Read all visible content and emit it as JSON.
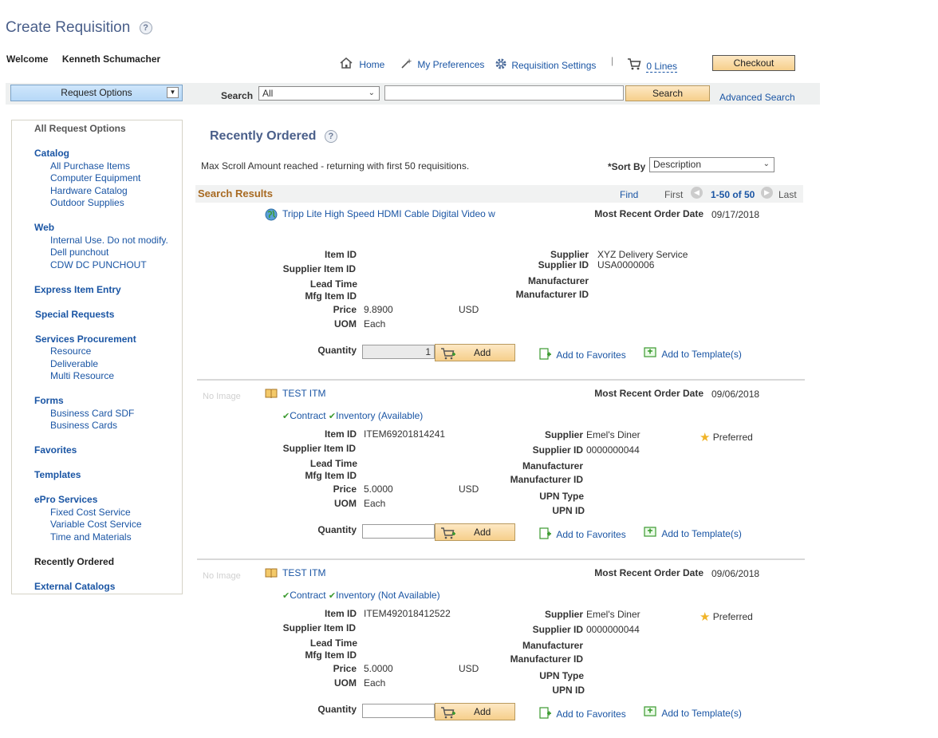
{
  "header": {
    "title": "Create Requisition",
    "help": "?",
    "welcome_label": "Welcome",
    "user_name": "Kenneth Schumacher"
  },
  "topnav": {
    "home": "Home",
    "preferences": "My Preferences",
    "settings": "Requisition Settings",
    "separator": "|",
    "cart_lines": "0 Lines",
    "checkout": "Checkout"
  },
  "toolbar": {
    "request_options": "Request Options",
    "search_label": "Search",
    "search_scope": "All",
    "search_value": "",
    "search_button": "Search",
    "advanced_search": "Advanced Search"
  },
  "sidebar": {
    "all_request_options": "All Request Options",
    "catalog": "Catalog",
    "catalog_items": [
      "All Purchase Items",
      "Computer Equipment",
      "Hardware Catalog",
      "Outdoor Supplies"
    ],
    "web": "Web",
    "web_items": [
      "Internal Use. Do not modify.",
      "Dell punchout",
      "CDW DC PUNCHOUT"
    ],
    "express": "Express Item Entry",
    "special": "Special Requests",
    "services": "Services Procurement",
    "services_items": [
      "Resource",
      "Deliverable",
      "Multi Resource"
    ],
    "forms": "Forms",
    "forms_items": [
      "Business Card SDF",
      "Business Cards"
    ],
    "favorites": "Favorites",
    "templates": "Templates",
    "epro": "ePro Services",
    "epro_items": [
      "Fixed Cost Service",
      "Variable Cost Service",
      "Time and Materials"
    ],
    "recently_ordered": "Recently Ordered",
    "external": "External Catalogs"
  },
  "main": {
    "title": "Recently Ordered",
    "help": "?",
    "scroll_msg": "Max Scroll Amount reached - returning with first 50 requisitions.",
    "sort_label": "*Sort By",
    "sort_value": "Description",
    "results_title": "Search Results",
    "find": "Find",
    "first": "First",
    "range": "1-50 of 50",
    "last": "Last"
  },
  "labels": {
    "item_id": "Item ID",
    "supplier_item_id": "Supplier Item ID",
    "lead_time": "Lead Time",
    "mfg_item_id": "Mfg Item ID",
    "price": "Price",
    "uom": "UOM",
    "quantity": "Quantity",
    "supplier": "Supplier",
    "supplier_id": "Supplier ID",
    "manufacturer": "Manufacturer",
    "manufacturer_id": "Manufacturer ID",
    "upn_type": "UPN Type",
    "upn_id": "UPN ID",
    "most_recent": "Most Recent Order Date",
    "add": "Add",
    "add_favorites": "Add to Favorites",
    "add_template": "Add to Template(s)",
    "no_image": "No Image",
    "preferred": "Preferred",
    "contract": "Contract"
  },
  "items": [
    {
      "title": "Tripp Lite High Speed HDMI Cable Digital Video w",
      "order_date": "09/17/2018",
      "item_id": "",
      "supplier": "XYZ Delivery Service",
      "supplier_id": "USA0000006",
      "price": "9.8900",
      "currency": "USD",
      "uom": "Each",
      "quantity": "1"
    },
    {
      "title": "TEST ITM",
      "order_date": "09/06/2018",
      "inventory": "Inventory (Available)",
      "item_id": "ITEM69201814241",
      "supplier": "Emel's Diner",
      "supplier_id": "0000000044",
      "price": "5.0000",
      "currency": "USD",
      "uom": "Each",
      "quantity": ""
    },
    {
      "title": "TEST ITM",
      "order_date": "09/06/2018",
      "inventory": "Inventory (Not Available)",
      "item_id": "ITEM492018412522",
      "supplier": "Emel's Diner",
      "supplier_id": "0000000044",
      "price": "5.0000",
      "currency": "USD",
      "uom": "Each",
      "quantity": ""
    }
  ]
}
